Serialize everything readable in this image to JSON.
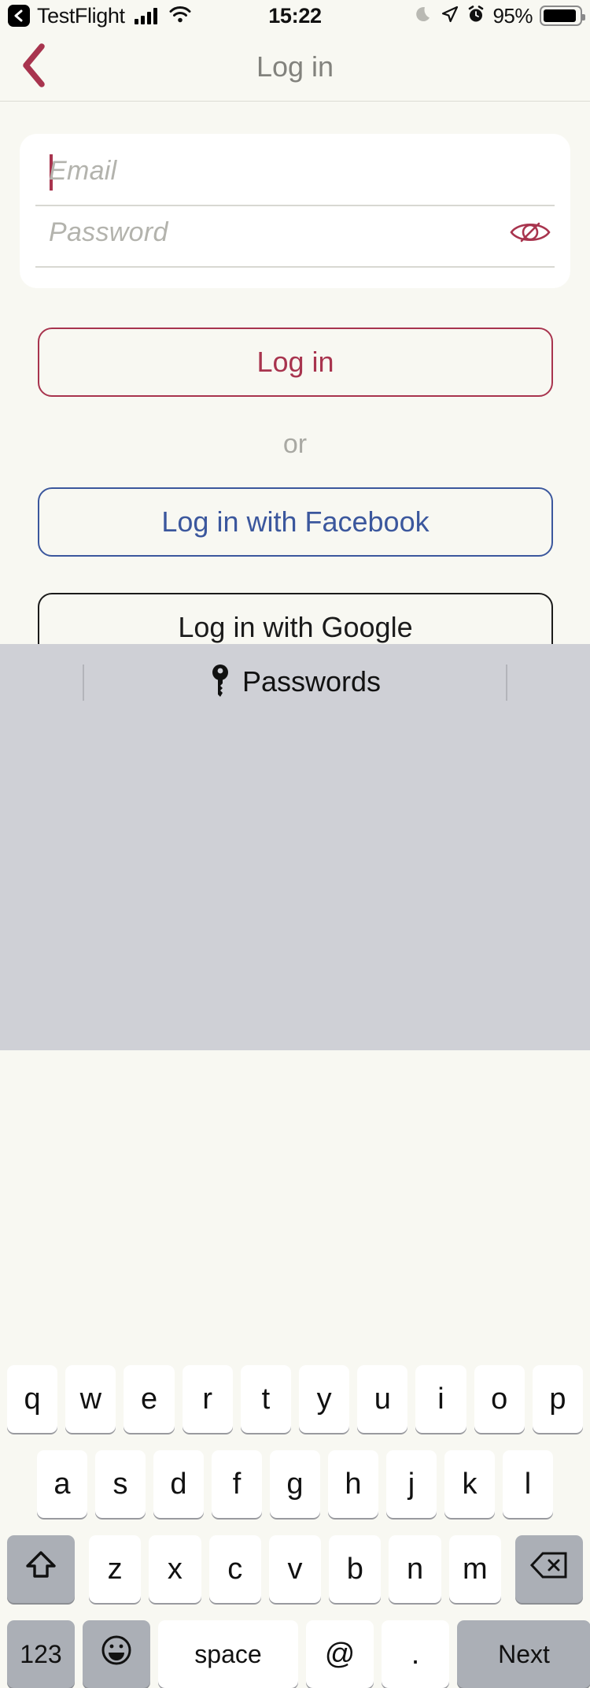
{
  "statusbar": {
    "app_badge_icon": "back-chevron-badge-icon",
    "app_name": "TestFlight",
    "signal_icon": "cellular-signal-icon",
    "wifi_icon": "wifi-icon",
    "time": "15:22",
    "dnd_icon": "moon-icon",
    "location_icon": "location-arrow-icon",
    "alarm_icon": "alarm-clock-icon",
    "battery_percent": "95%",
    "battery_icon": "battery-icon"
  },
  "navbar": {
    "back_icon": "chevron-left-icon",
    "title": "Log in"
  },
  "form": {
    "email": {
      "placeholder": "Email",
      "value": "",
      "focused": true
    },
    "password": {
      "placeholder": "Password",
      "value": "",
      "reveal_icon": "eye-slash-icon"
    }
  },
  "actions": {
    "login": "Log in",
    "or": "or",
    "facebook": "Log in with Facebook",
    "google": "Log in with Google"
  },
  "colors": {
    "accent": "#A8344E",
    "facebook": "#3B579D",
    "google": "#1B1B1B",
    "page_background": "#F8F8F2",
    "card_background": "#FFFFFF",
    "placeholder": "#B3B3AD",
    "keyboard_background": "#CFD0D6",
    "key_background": "#FFFFFF",
    "key_dark_background": "#ABAFB6"
  },
  "keyboard": {
    "suggestion_bar": {
      "key_icon": "key-icon",
      "label": "Passwords"
    },
    "rows": [
      [
        "q",
        "w",
        "e",
        "r",
        "t",
        "y",
        "u",
        "i",
        "o",
        "p"
      ],
      [
        "a",
        "s",
        "d",
        "f",
        "g",
        "h",
        "j",
        "k",
        "l"
      ],
      [
        "z",
        "x",
        "c",
        "v",
        "b",
        "n",
        "m"
      ]
    ],
    "shift_icon": "shift-arrow-icon",
    "backspace_icon": "backspace-delete-icon",
    "numbers_key": "123",
    "emoji_icon": "emoji-smiley-icon",
    "space_key": "space",
    "at_key": "@",
    "period_key": ".",
    "return_key": "Next"
  }
}
